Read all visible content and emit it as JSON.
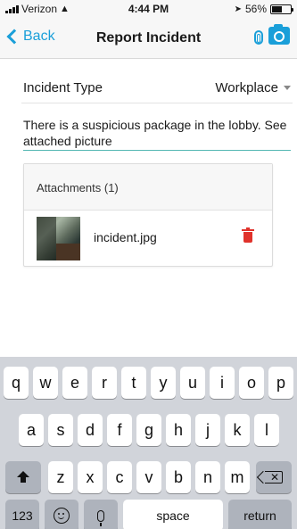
{
  "status_bar": {
    "carrier": "Verizon",
    "time": "4:44 PM",
    "battery": "56%",
    "battery_level": 0.56
  },
  "nav": {
    "back_label": "Back",
    "title": "Report Incident",
    "icons": [
      "paperclip-icon",
      "camera-icon"
    ],
    "accent_color": "#1a9fd9"
  },
  "form": {
    "incident_type_label": "Incident Type",
    "incident_type_value": "Workplace",
    "description": "There is a suspicious package in the lobby. See attached picture"
  },
  "attachments": {
    "title": "Attachments (1)",
    "items": [
      {
        "file_name": "incident.jpg",
        "delete_color": "#e0322b"
      }
    ]
  },
  "keyboard": {
    "row1": [
      "q",
      "w",
      "e",
      "r",
      "t",
      "y",
      "u",
      "i",
      "o",
      "p"
    ],
    "row2": [
      "a",
      "s",
      "d",
      "f",
      "g",
      "h",
      "j",
      "k",
      "l"
    ],
    "row3": [
      "z",
      "x",
      "c",
      "v",
      "b",
      "n",
      "m"
    ],
    "numbers_label": "123",
    "space_label": "space",
    "return_label": "return"
  }
}
